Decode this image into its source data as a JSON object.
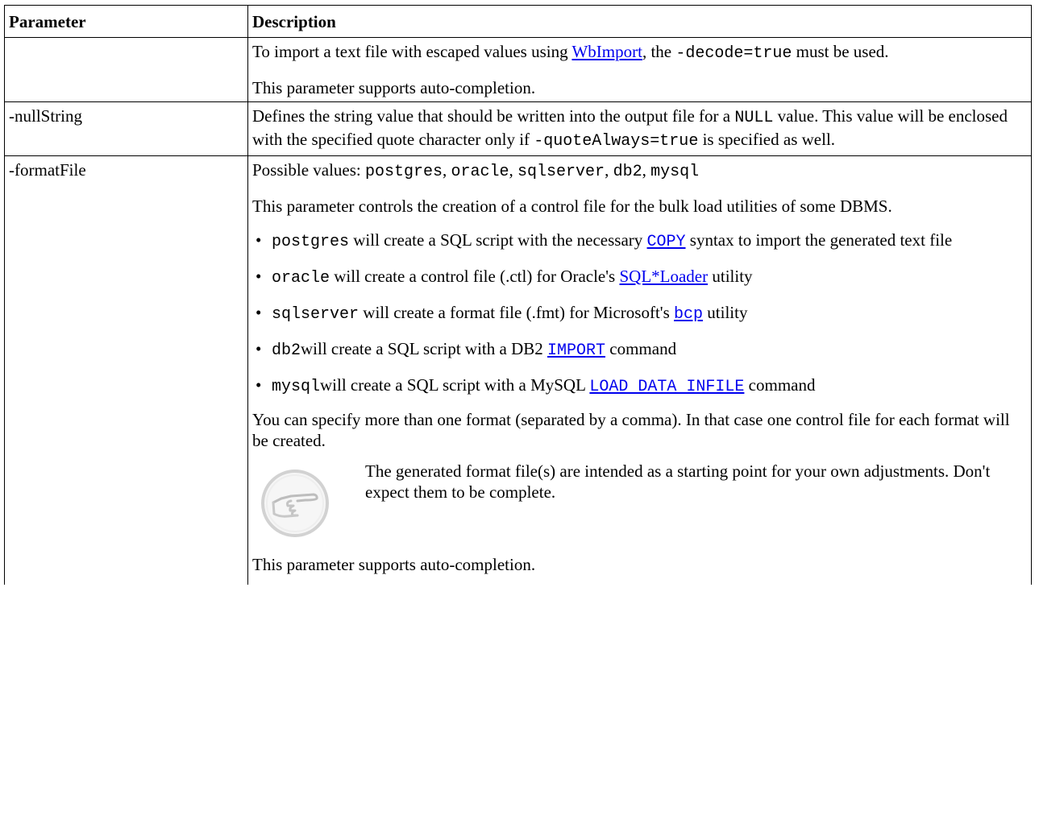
{
  "table": {
    "headers": {
      "parameter": "Parameter",
      "description": "Description"
    },
    "row1": {
      "parameter": "",
      "line1_a": "To import a text file with escaped values using ",
      "line1_link": "WbImport",
      "line1_b": ", the ",
      "line1_code": "-decode=true",
      "line1_c": " must be used.",
      "line2": "This parameter supports auto-completion."
    },
    "row2": {
      "parameter": "-nullString",
      "text_a": "Defines the string value that should be written into the output file for a ",
      "code1": "NULL",
      "text_b": " value. This value will be enclosed with the specified quote character only if ",
      "code2": "-quoteAlways=true",
      "text_c": " is specified as well."
    },
    "row3": {
      "parameter": "-formatFile",
      "possible_label": "Possible values: ",
      "values": [
        "postgres",
        "oracle",
        "sqlserver",
        "db2",
        "mysql"
      ],
      "sep": ", ",
      "intro": "This parameter controls the creation of a control file for the bulk load utilities of some DBMS.",
      "bullets": [
        {
          "code": "postgres",
          "text_a": " will create a SQL script with the necessary ",
          "link": "COPY",
          "text_b": " syntax to import the generated text file"
        },
        {
          "code": "oracle",
          "text_a": " will create a control file (.ctl) for Oracle's ",
          "link": "SQL*Loader",
          "text_b": " utility"
        },
        {
          "code": "sqlserver",
          "text_a": " will create a format file (.fmt) for Microsoft's ",
          "link": "bcp",
          "text_b": " utility"
        },
        {
          "code": "db2",
          "text_a": "will create a SQL script with a DB2 ",
          "link": "IMPORT",
          "text_b": " command"
        },
        {
          "code": "mysql",
          "text_a": "will create a SQL script with a MySQL ",
          "link": "LOAD DATA INFILE",
          "text_b": " command"
        }
      ],
      "multi_format": "You can specify more than one format (separated by a comma). In that case one control file for each format will be created.",
      "note": "The generated format file(s) are intended as a starting point for your own adjustments. Don't expect them to be complete.",
      "autocomplete": "This parameter supports auto-completion."
    }
  },
  "icons": {
    "note_icon": "pointing-hand-note-icon"
  },
  "colors": {
    "link": "#0000ee",
    "border": "#000000"
  }
}
